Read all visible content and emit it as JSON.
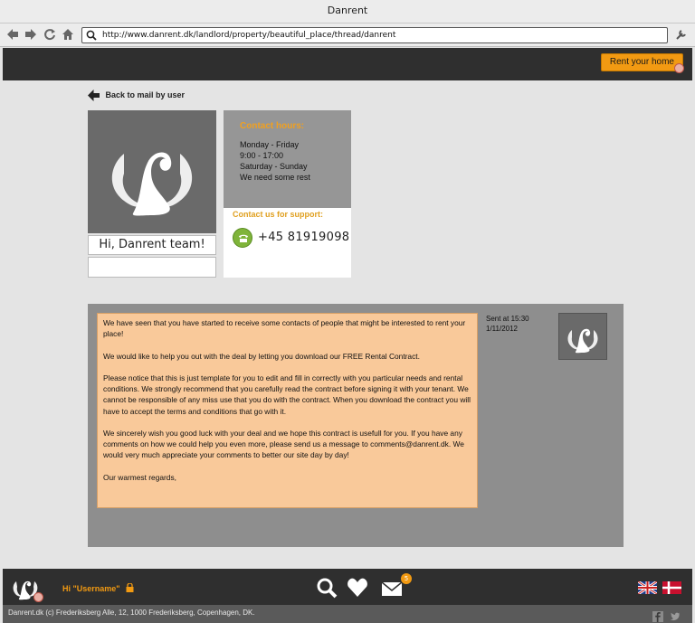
{
  "window": {
    "title": "Danrent"
  },
  "browser": {
    "url": "http://www.danrent.dk/landlord/property/beautiful_place/thread/danrent"
  },
  "header": {
    "rent_button": "Rent your home"
  },
  "back_link": "Back to mail by user",
  "profile": {
    "greeting": "Hi, Danrent team!"
  },
  "contact": {
    "hours_title": "Contact hours:",
    "hours": [
      "Monday - Friday",
      "9:00 - 17:00",
      "Saturday - Sunday",
      "We need some rest"
    ],
    "support_title": "Contact us for support:",
    "phone": "+45 81919098"
  },
  "message": {
    "paragraphs": [
      "We have seen that you have started to receive some contacts of people that might be interested to rent your place!",
      "We would like to help you out with the deal by letting you download our FREE Rental Contract.",
      "Please notice that this is just template for you to edit and fill in correctly with you particular needs and rental conditions. We strongly recommend that you carefully read the contract before signing it with your tenant. We cannot be responsible of any miss use that you do with the contract. When you download the contract you will have to accept the terms and conditions that go with it.",
      "We sincerely wish you good luck with your deal and we hope this contract is usefull for you. If you have any comments on how we could help you even more, please send us  a message to comments@danrent.dk. We would very much appreciate your comments to better our site day by day!",
      "Our warmest regards,"
    ],
    "sent_label": "Sent at 15:30",
    "sent_date": "1/11/2012"
  },
  "footer": {
    "greeting": "Hi \"Username\"",
    "mail_count": "5",
    "copyright": "Danrent.dk (c) Frederiksberg Alle, 12, 1000 Frederiksberg, Copenhagen, DK."
  },
  "colors": {
    "accent": "#f29a12",
    "dark_bar": "#2f2f2f",
    "message_bg": "#f9c99a",
    "panel_bg": "#8e8e8e"
  }
}
